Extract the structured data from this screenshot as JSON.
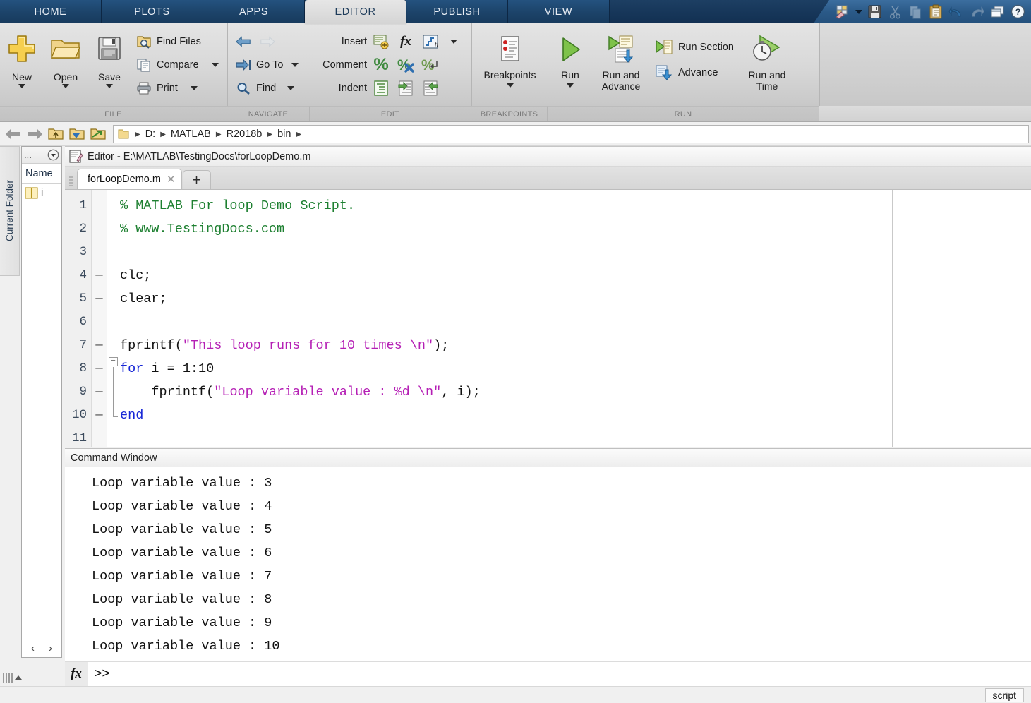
{
  "app": {
    "title": "MATLAB R2018b"
  },
  "ribbon": {
    "tabs": [
      {
        "label": "HOME",
        "active": false
      },
      {
        "label": "PLOTS",
        "active": false
      },
      {
        "label": "APPS",
        "active": false
      },
      {
        "label": "EDITOR",
        "active": true
      },
      {
        "label": "PUBLISH",
        "active": false
      },
      {
        "label": "VIEW",
        "active": false
      }
    ],
    "quick_access": [
      {
        "name": "layout-eraser-icon",
        "tooltip": "Layout"
      },
      {
        "name": "chevron-down-icon",
        "tooltip": "More"
      },
      {
        "name": "save-icon",
        "tooltip": "Save"
      },
      {
        "name": "cut-icon",
        "tooltip": "Cut",
        "disabled": true
      },
      {
        "name": "copy-icon",
        "tooltip": "Copy",
        "disabled": true
      },
      {
        "name": "paste-icon",
        "tooltip": "Paste"
      },
      {
        "name": "undo-icon",
        "tooltip": "Undo"
      },
      {
        "name": "redo-icon",
        "tooltip": "Redo",
        "disabled": true
      },
      {
        "name": "switch-windows-icon",
        "tooltip": "Switch Windows"
      },
      {
        "name": "help-icon",
        "tooltip": "Help"
      }
    ],
    "groups": [
      {
        "name": "FILE",
        "label": "FILE",
        "big_buttons": [
          {
            "label": "New",
            "icon": "new-plus-icon",
            "has_caret": true
          },
          {
            "label": "Open",
            "icon": "open-folder-icon",
            "has_caret": true
          },
          {
            "label": "Save",
            "icon": "save-floppy-icon",
            "has_caret": true
          }
        ],
        "small_buttons": [
          {
            "label": "Find Files",
            "icon": "find-files-icon",
            "has_caret": false
          },
          {
            "label": "Compare",
            "icon": "compare-icon",
            "has_caret": true
          },
          {
            "label": "Print",
            "icon": "print-icon",
            "has_caret": true
          }
        ]
      },
      {
        "name": "NAVIGATE",
        "label": "NAVIGATE",
        "small_buttons": [
          {
            "label": "",
            "icon": "back-arrow-icon",
            "has_caret": false
          },
          {
            "label": "",
            "icon": "forward-arrow-icon",
            "has_caret": false,
            "disabled": true
          },
          {
            "label": "Go To",
            "icon": "go-to-icon",
            "has_caret": true
          },
          {
            "label": "Find",
            "icon": "find-magnifier-icon",
            "has_caret": true
          }
        ]
      },
      {
        "name": "EDIT",
        "label": "EDIT",
        "rows": [
          {
            "label": "Insert",
            "icons": [
              "insert-section-icon",
              "insert-function-icon",
              "insert-if-icon"
            ],
            "has_caret": true
          },
          {
            "label": "Comment",
            "icons": [
              "comment-icon",
              "uncomment-icon",
              "wrap-comment-icon"
            ],
            "has_caret": false
          },
          {
            "label": "Indent",
            "icons": [
              "smart-indent-icon",
              "indent-right-icon",
              "indent-left-icon"
            ],
            "has_caret": false
          }
        ]
      },
      {
        "name": "BREAKPOINTS",
        "label": "BREAKPOINTS",
        "big_buttons": [
          {
            "label": "Breakpoints",
            "icon": "breakpoints-icon",
            "has_caret": true
          }
        ]
      },
      {
        "name": "RUN",
        "label": "RUN",
        "big_buttons": [
          {
            "label": "Run",
            "icon": "run-play-icon",
            "has_caret": true
          },
          {
            "label": "Run and\nAdvance",
            "icon": "run-and-advance-icon",
            "has_caret": false
          },
          {
            "label": "Run and\nTime",
            "icon": "run-and-time-icon",
            "has_caret": false
          }
        ],
        "small_buttons": [
          {
            "label": "Run Section",
            "icon": "run-section-icon"
          },
          {
            "label": "Advance",
            "icon": "advance-icon"
          }
        ]
      }
    ]
  },
  "address_bar": {
    "nav_icons": [
      {
        "name": "back-arrow-icon"
      },
      {
        "name": "forward-arrow-icon"
      },
      {
        "name": "up-folder-icon"
      },
      {
        "name": "browse-folder-icon"
      },
      {
        "name": "goto-folder-icon"
      }
    ],
    "crumbs": [
      "D:",
      "MATLAB",
      "R2018b",
      "bin"
    ]
  },
  "current_folder": {
    "strip_label": "Current Folder",
    "header_ellipsis": "...",
    "column_header": "Name",
    "items": [
      {
        "name": "i",
        "icon": "variable-grid-icon"
      }
    ],
    "nav_prev": "‹",
    "nav_next": "›"
  },
  "editor": {
    "header_title": "Editor - E:\\MATLAB\\TestingDocs\\forLoopDemo.m",
    "header_icon": "editor-pencil-icon",
    "tabs": [
      {
        "label": "forLoopDemo.m",
        "close": "✕",
        "active": true
      }
    ],
    "new_tab_label": "+",
    "line_numbers": [
      "1",
      "2",
      "3",
      "4",
      "5",
      "6",
      "7",
      "8",
      "9",
      "10",
      "11"
    ],
    "executable_marks": [
      "",
      "",
      "",
      "—",
      "—",
      "",
      "—",
      "—",
      "—",
      "—",
      ""
    ],
    "lines": [
      {
        "n": 1,
        "tokens": [
          {
            "t": "comment",
            "s": "% MATLAB For loop Demo Script."
          }
        ]
      },
      {
        "n": 2,
        "tokens": [
          {
            "t": "comment",
            "s": "% www.TestingDocs.com"
          }
        ]
      },
      {
        "n": 3,
        "tokens": []
      },
      {
        "n": 4,
        "tokens": [
          {
            "t": "plain",
            "s": "clc;"
          }
        ]
      },
      {
        "n": 5,
        "tokens": [
          {
            "t": "plain",
            "s": "clear;"
          }
        ]
      },
      {
        "n": 6,
        "tokens": []
      },
      {
        "n": 7,
        "tokens": [
          {
            "t": "plain",
            "s": "fprintf("
          },
          {
            "t": "str",
            "s": "\"This loop runs for 10 times \\n\""
          },
          {
            "t": "plain",
            "s": ");"
          }
        ]
      },
      {
        "n": 8,
        "tokens": [
          {
            "t": "kw",
            "s": "for"
          },
          {
            "t": "plain",
            "s": " i = 1:10"
          }
        ]
      },
      {
        "n": 9,
        "tokens": [
          {
            "t": "plain",
            "s": "    fprintf("
          },
          {
            "t": "str",
            "s": "\"Loop variable value : %d \\n\""
          },
          {
            "t": "plain",
            "s": ", i);"
          }
        ]
      },
      {
        "n": 10,
        "tokens": [
          {
            "t": "kw",
            "s": "end"
          }
        ]
      },
      {
        "n": 11,
        "tokens": []
      }
    ],
    "colors": {
      "comment": "#1e8031",
      "keyword": "#1626d6",
      "string": "#b51fb5",
      "plain": "#111111"
    }
  },
  "command_window": {
    "title": "Command Window",
    "output_lines": [
      "Loop variable value : 3",
      "Loop variable value : 4",
      "Loop variable value : 5",
      "Loop variable value : 6",
      "Loop variable value : 7",
      "Loop variable value : 8",
      "Loop variable value : 9",
      "Loop variable value : 10"
    ],
    "fx_label": "fx",
    "prompt": ">>"
  },
  "status_bar": {
    "file_type": "script"
  }
}
